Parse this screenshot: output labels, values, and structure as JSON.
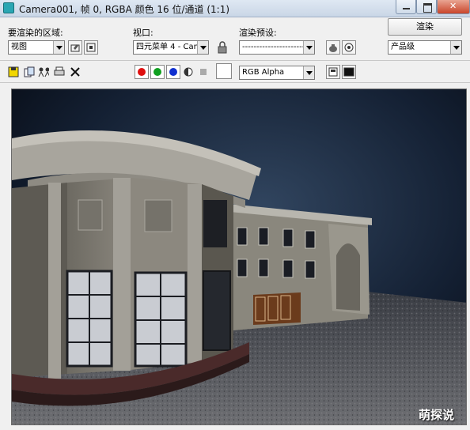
{
  "window": {
    "title": "Camera001, 帧 0, RGBA 颜色 16 位/通道 (1:1)",
    "icon": "app-icon"
  },
  "controls": {
    "area_label": "要渲染的区域:",
    "area_value": "视图",
    "viewport_label": "视口:",
    "viewport_value": "四元菜单 4 - Can",
    "preset_label": "渲染预设:",
    "preset_value": "----------------------",
    "render_button": "渲染",
    "quality_value": "产品级"
  },
  "toolbar": {
    "channel_value": "RGB Alpha",
    "channel_colors": {
      "red": "#e01010",
      "green": "#10a020",
      "blue": "#1030d0"
    }
  },
  "watermark": "萌探说"
}
